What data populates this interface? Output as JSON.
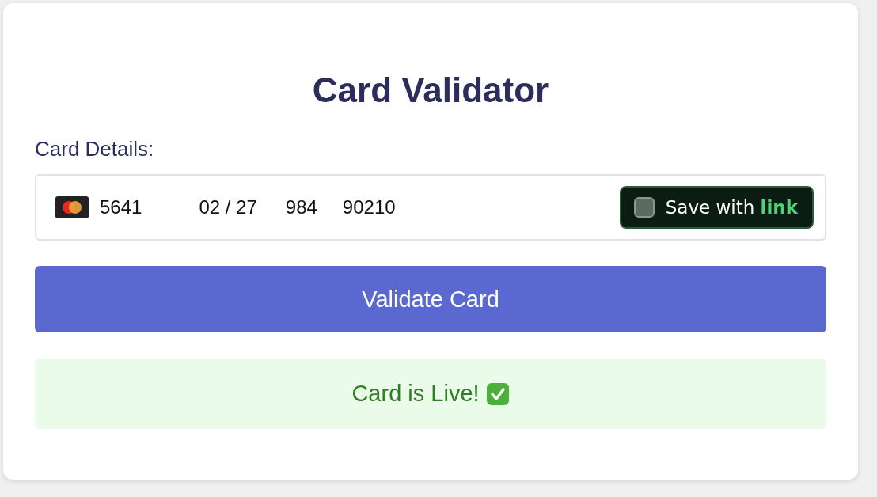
{
  "title": "Card Validator",
  "field_label": "Card Details:",
  "card_field": {
    "number": "5641",
    "expiry": "02 / 27",
    "cvc": "984",
    "zip": "90210"
  },
  "save_link": {
    "label": "Save with **link**",
    "checked": false
  },
  "button": "Validate Card",
  "result": {
    "text": "Card is Live!",
    "live": true
  }
}
